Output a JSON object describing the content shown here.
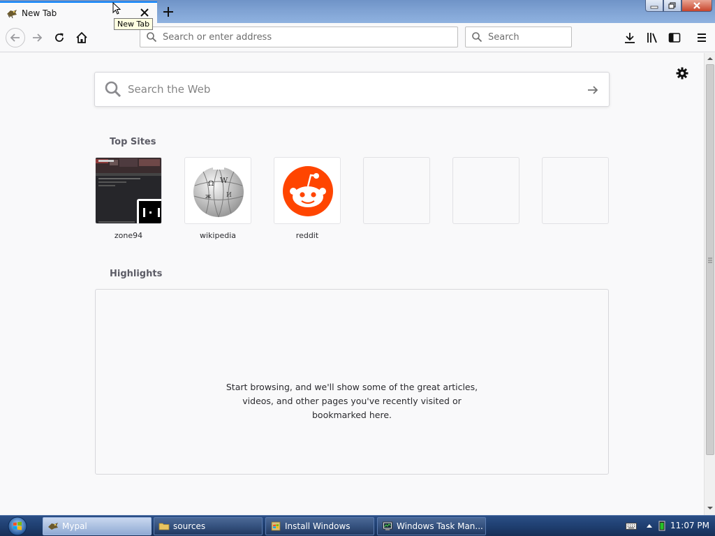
{
  "window": {
    "tab_title": "New Tab",
    "tooltip": "New Tab"
  },
  "toolbar": {
    "url_placeholder": "Search or enter address",
    "search_placeholder": "Search"
  },
  "content": {
    "web_search_placeholder": "Search the Web",
    "top_sites_title": "Top Sites",
    "top_sites": [
      {
        "label": "zone94"
      },
      {
        "label": "wikipedia"
      },
      {
        "label": "reddit"
      }
    ],
    "highlights_title": "Highlights",
    "highlights_message": [
      "Start browsing, and we'll show some of the great articles,",
      "videos, and other pages you've recently visited or",
      "bookmarked here."
    ]
  },
  "taskbar": {
    "tasks": [
      {
        "label": "Mypal",
        "icon": "mypal-icon",
        "active": true
      },
      {
        "label": "sources",
        "icon": "folder-icon",
        "active": false
      },
      {
        "label": "Install Windows",
        "icon": "setup-icon",
        "active": false
      },
      {
        "label": "Windows Task Man...",
        "icon": "task-manager-icon",
        "active": false
      }
    ],
    "clock": "11:07 PM"
  },
  "colors": {
    "accent": "#0a84ff",
    "reddit": "#ff4500",
    "taskbar": "#1f3f71"
  }
}
